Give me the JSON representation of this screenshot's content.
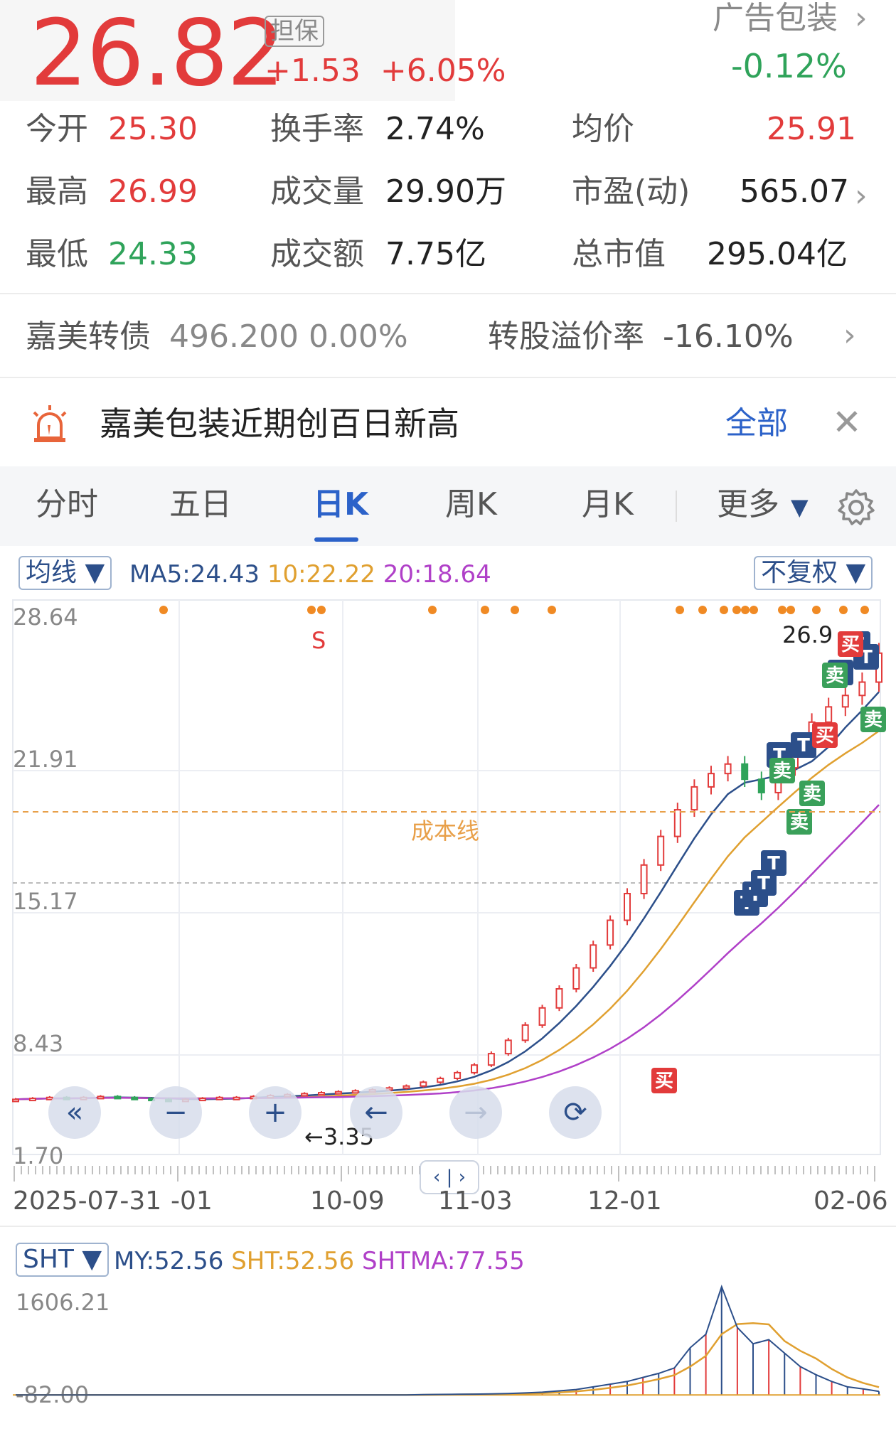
{
  "header": {
    "price": "26.82",
    "guarantee_tag": "担保",
    "change": "+1.53",
    "change_pct": "+6.05%",
    "industry": "广告包装",
    "industry_change": "-0.12%"
  },
  "stats": {
    "open_label": "今开",
    "open": "25.30",
    "high_label": "最高",
    "high": "26.99",
    "low_label": "最低",
    "low": "24.33",
    "turnover_label": "换手率",
    "turnover": "2.74%",
    "volume_label": "成交量",
    "volume": "29.90万",
    "amount_label": "成交额",
    "amount": "7.75亿",
    "avg_label": "均价",
    "avg": "25.91",
    "pe_label": "市盈(动)",
    "pe": "565.07",
    "mcap_label": "总市值",
    "mcap": "295.04亿"
  },
  "convertible": {
    "name": "嘉美转债",
    "value": "496.200 0.00%",
    "premium_label": "转股溢价率",
    "premium": "-16.10%"
  },
  "alert": {
    "text": "嘉美包装近期创百日新高",
    "all_label": "全部"
  },
  "tabs": {
    "intraday": "分时",
    "five_day": "五日",
    "daily": "日K",
    "weekly": "周K",
    "monthly": "月K",
    "more": "更多"
  },
  "chart_data": [
    {
      "type": "candlestick",
      "indicator_selector": "均线",
      "adjust_selector": "不复权",
      "legend": [
        {
          "name": "MA5",
          "text": "MA5:24.43",
          "color": "#2c4f8a"
        },
        {
          "name": "MA10",
          "text": "10:22.22",
          "color": "#e0a030"
        },
        {
          "name": "MA20",
          "text": "20:18.64",
          "color": "#b040c8"
        }
      ],
      "y_ticks": [
        "28.64",
        "21.91",
        "15.17",
        "8.43",
        "1.70"
      ],
      "ylim": [
        1.7,
        28.64
      ],
      "x_ticks": [
        "2025-07-31",
        "-01",
        "10-09",
        "11-03",
        "12-01",
        "02-06"
      ],
      "cost_line": {
        "label": "成本线",
        "value": 19.0
      },
      "annotations": {
        "max_label": "26.9",
        "min_label": "3.35",
        "s_mark": "S",
        "buy": "买",
        "sell": "卖",
        "t": "T"
      },
      "series_close": [
        3.4,
        3.45,
        3.5,
        3.45,
        3.5,
        3.55,
        3.5,
        3.45,
        3.4,
        3.35,
        3.4,
        3.45,
        3.5,
        3.5,
        3.55,
        3.6,
        3.65,
        3.7,
        3.75,
        3.8,
        3.85,
        3.9,
        4.0,
        4.1,
        4.3,
        4.5,
        4.8,
        5.2,
        5.8,
        6.5,
        7.3,
        8.2,
        9.2,
        10.3,
        11.5,
        12.8,
        14.2,
        15.7,
        17.2,
        18.6,
        19.8,
        20.5,
        21.0,
        20.2,
        19.5,
        20.8,
        22.0,
        23.2,
        24.0,
        24.6,
        25.3,
        26.82
      ]
    },
    {
      "type": "bar",
      "indicator_selector": "SHT",
      "legend": [
        {
          "name": "MY",
          "text": "MY:52.56",
          "color": "#2c4f8a"
        },
        {
          "name": "SHT",
          "text": "SHT:52.56",
          "color": "#e0a030"
        },
        {
          "name": "SHTMA",
          "text": "SHTMA:77.55",
          "color": "#b040c8"
        }
      ],
      "y_ticks": [
        "1606.21",
        "-82.00"
      ],
      "ylim": [
        -82.0,
        1606.21
      ],
      "values": [
        0,
        0,
        0,
        0,
        0,
        0,
        0,
        0,
        0,
        0,
        0,
        0,
        0,
        0,
        0,
        0,
        0,
        0,
        0,
        0,
        0,
        0,
        0,
        0,
        5,
        8,
        10,
        12,
        15,
        20,
        30,
        40,
        60,
        80,
        120,
        160,
        200,
        260,
        320,
        400,
        700,
        900,
        1606,
        1000,
        760,
        820,
        620,
        420,
        300,
        200,
        120,
        90,
        52.56
      ]
    }
  ],
  "controls": {
    "rewind": "«",
    "zoom_out": "−",
    "zoom_in": "+",
    "back": "←",
    "forward": "→",
    "rotate": "⟳"
  }
}
